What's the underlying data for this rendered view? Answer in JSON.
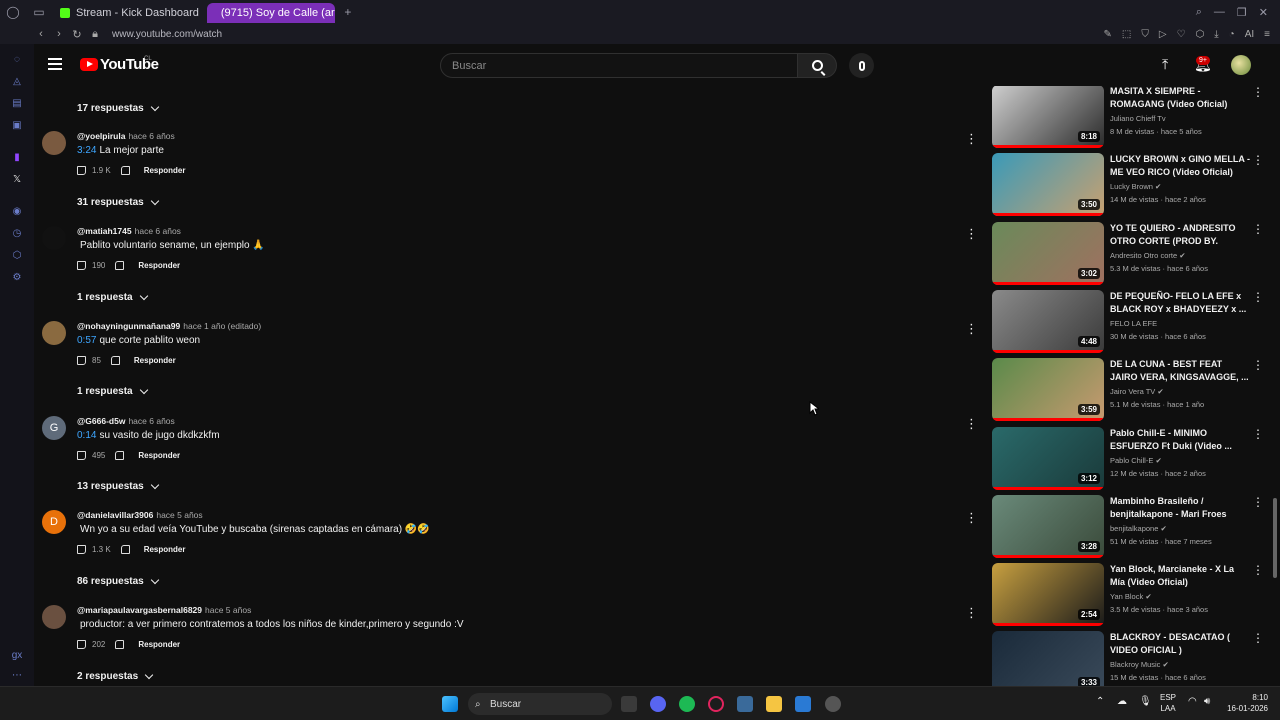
{
  "browser": {
    "tabs": [
      {
        "label": "Stream - Kick Dashboard",
        "color": "#53fc18"
      },
      {
        "label": "(9715) Soy de Calle (ar",
        "color": "#ff0000"
      }
    ],
    "url": "www.youtube.com/watch",
    "ai_label": "AI"
  },
  "header": {
    "logo_text": "YouTube",
    "country_code": "CL",
    "search_placeholder": "Buscar",
    "notifications_badge": "9+"
  },
  "comments": {
    "reply_label": "Responder",
    "top_replies": "17 respuestas",
    "items": [
      {
        "handle": "@yoelpirula",
        "time": "hace 6 años",
        "timestamp": "3:24",
        "text": "La mejor parte",
        "likes": "1.9 K",
        "replies": "31 respuestas",
        "avatar_color": "#7a5a40",
        "initial": ""
      },
      {
        "handle": "@matiah1745",
        "time": "hace 6 años",
        "timestamp": "",
        "text": "Pablito voluntario sename, un ejemplo 🙏",
        "likes": "190",
        "replies": "1 respuesta",
        "avatar_color": "#111111",
        "initial": ""
      },
      {
        "handle": "@nohayningunmañana99",
        "time": "hace 1 año (editado)",
        "timestamp": "0:57",
        "text": "que corte pablito weon",
        "likes": "85",
        "replies": "1 respuesta",
        "avatar_color": "#8a6a40",
        "initial": ""
      },
      {
        "handle": "@G666-d5w",
        "time": "hace 6 años",
        "timestamp": "0:14",
        "text": "su vasito de jugo dkdkzkfm",
        "likes": "495",
        "replies": "13 respuestas",
        "avatar_color": "#5f6b7a",
        "initial": "G"
      },
      {
        "handle": "@danielavillar3906",
        "time": "hace 5 años",
        "timestamp": "",
        "text": "Wn yo a su edad veía YouTube y buscaba (sirenas captadas en cámara) 🤣🤣",
        "likes": "1.3 K",
        "replies": "86 respuestas",
        "avatar_color": "#e8710a",
        "initial": "D"
      },
      {
        "handle": "@mariapaulavargasbernal6829",
        "time": "hace 5 años",
        "timestamp": "",
        "text": "productor: a ver primero contratemos a todos los niños de kinder,primero y segundo :V",
        "likes": "202",
        "replies": "2 respuestas",
        "avatar_color": "#6a5040",
        "initial": ""
      }
    ]
  },
  "related": [
    {
      "title": "MASITA X SIEMPRE - ROMAGANG (Video Oficial)",
      "channel": "Juliano Chieff Tv",
      "meta": "8 M de vistas · hace 5 años",
      "duration": "8:18",
      "thumb": "#cfcfcf",
      "thumb2": "#2a2a2a",
      "verified": false
    },
    {
      "title": "LUCKY BROWN x GINO MELLA - ME VEO RICO (Video Oficial)",
      "channel": "Lucky Brown",
      "meta": "14 M de vistas · hace 2 años",
      "duration": "3:50",
      "thumb": "#3a9ab8",
      "thumb2": "#c8a070",
      "verified": true
    },
    {
      "title": "YO TE QUIERO - ANDRESITO OTRO CORTE (PROD BY. DAKO...",
      "channel": "Andresito Otro corte",
      "meta": "5.3 M de vistas · hace 6 años",
      "duration": "3:02",
      "thumb": "#6a8a5a",
      "thumb2": "#a07060",
      "verified": true
    },
    {
      "title": "DE PEQUEÑO-  FELO LA EFE x BLACK ROY x BHADYEEZY x ...",
      "channel": "FELO LA EFE",
      "meta": "30 M de vistas · hace 6 años",
      "duration": "4:48",
      "thumb": "#8a8a8a",
      "thumb2": "#3a3a3a",
      "verified": false
    },
    {
      "title": "DE LA CUNA - BEST FEAT JAIRO VERA, KINGSAVAGGE, ...",
      "channel": "Jairo Vera TV",
      "meta": "5.1 M de vistas · hace 1 año",
      "duration": "3:59",
      "thumb": "#5a8a4a",
      "thumb2": "#c89a70",
      "verified": true
    },
    {
      "title": "Pablo Chill-E - MINIMO ESFUERZO Ft Duki (Video ...",
      "channel": "Pablo Chill-E",
      "meta": "12 M de vistas · hace 2 años",
      "duration": "3:12",
      "thumb": "#2a6a6a",
      "thumb2": "#1a3a3a",
      "verified": true
    },
    {
      "title": "Mambinho Brasileño / benjitalkapone - Mari Froes",
      "channel": "benjitalkapone",
      "meta": "51 M de vistas · hace 7 meses",
      "duration": "3:28",
      "thumb": "#6a8a7a",
      "thumb2": "#3a4a3a",
      "verified": true
    },
    {
      "title": "Yan Block, Marcianeke - X La Mía (Video Oficial)",
      "channel": "Yan Block",
      "meta": "3.5 M de vistas · hace 3 años",
      "duration": "2:54",
      "thumb": "#c8a040",
      "thumb2": "#1a1a1a",
      "verified": true
    },
    {
      "title": "BLACKROY - DESACATAO ( VIDEO OFICIAL )",
      "channel": "Blackroy Music",
      "meta": "15 M de vistas · hace 6 años",
      "duration": "3:33",
      "thumb": "#1a2a3a",
      "thumb2": "#3a4a5a",
      "verified": true
    }
  ],
  "taskbar": {
    "search_label": "Buscar",
    "lang_top": "ESP",
    "lang_bottom": "LAA",
    "time": "8:10",
    "date": "16-01-2026"
  }
}
